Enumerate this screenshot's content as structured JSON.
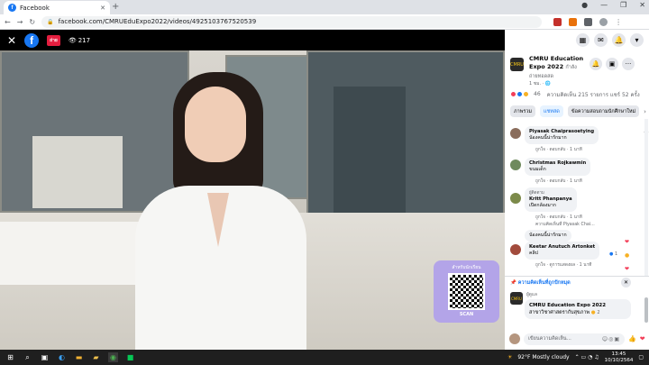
{
  "browser": {
    "tab_title": "Facebook",
    "url": "facebook.com/CMRUEduExpo2022/videos/4925103767520539"
  },
  "video": {
    "live_badge": "ถ่าย",
    "view_count": "217",
    "qr_label": "สำหรับนักเรียน",
    "qr_scan": "SCAN"
  },
  "panel": {
    "page_name": "CMRU Education Expo 2022",
    "page_suffix": "กำลังถ่ายทอดสด",
    "time": "1 ชม.",
    "reaction_count": "46",
    "stats_text": "ความคิดเห็น 215 รายการ  แชร์ 52 ครั้ง",
    "tabs": [
      "ภาพรวม",
      "แชทสด",
      "ข้อความสอบถามนักศึกษาใหม่"
    ],
    "comments": [
      {
        "name": "Piyasak Chaiprasoetying",
        "text": "น้องคนนี้น่ารักมาก",
        "meta": "ถูกใจ · ตอบกลับ · 1 นาที"
      },
      {
        "name": "Christmas Rojkawmin",
        "text": "ขนมเด็ก",
        "meta": "ถูกใจ · ตอบกลับ · 1 นาที"
      },
      {
        "label": "ผู้ติดตาม",
        "name": "Kritt Phanpanya",
        "text": "เปิดกล้องมาก",
        "meta": "ถูกใจ · ตอบกลับ · 1 นาที",
        "reply": "ความคิดเห็นที่ Piyasak Chai..."
      },
      {
        "text": "น้องคนนี้น่ารักมาก",
        "meta": "ถูกใจ · ตอบกลับ · 1 นาที"
      },
      {
        "name": "Keetar Anutuch Artonket",
        "text": "คลิป",
        "meta": "ถูกใจ · ดูการแสดงผล · 1 นาที",
        "reacts": "1"
      }
    ],
    "pinned_header": "ความคิดเห็นที่ถูกปักหมุด",
    "pinned_label": "ผู้ดูแล",
    "pinned_name": "CMRU Education Expo 2022",
    "pinned_text": "สาขาวิชาศาสตรากับสุขภาพ",
    "pinned_reacts": "2",
    "composer_placeholder": "เขียนความคิดเห็น..."
  },
  "taskbar": {
    "weather": "92°F  Mostly cloudy",
    "time": "13:45",
    "date": "10/10/2564"
  }
}
